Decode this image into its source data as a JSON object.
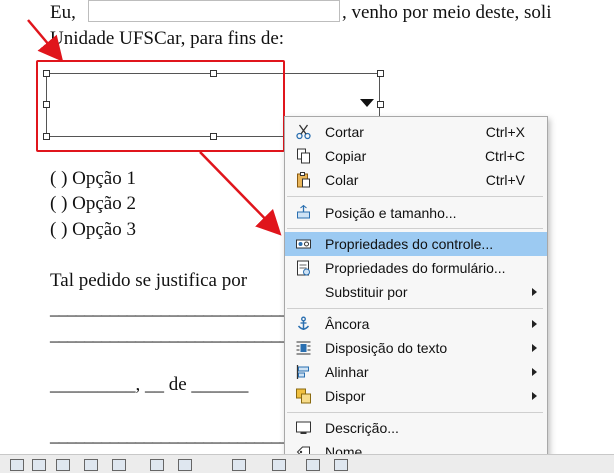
{
  "document": {
    "line1_start": "Eu,",
    "line1_end": ", venho por meio deste, soli",
    "line2": "Unidade UFSCar, para fins de:",
    "options": [
      "( ) Opção 1",
      "( ) Opção 2",
      "( ) Opção 3"
    ],
    "justify_text": "Tal pedido se justifica por",
    "date_line": "_________, __ de ______",
    "underscores": "___________________________________________"
  },
  "context_menu": {
    "items": [
      {
        "label": "Cortar",
        "shortcut": "Ctrl+X",
        "icon": "scissors-icon"
      },
      {
        "label": "Copiar",
        "shortcut": "Ctrl+C",
        "icon": "copy-icon"
      },
      {
        "label": "Colar",
        "shortcut": "Ctrl+V",
        "icon": "paste-icon"
      },
      {
        "label": "Posição e tamanho...",
        "icon": "position-size-icon"
      },
      {
        "label": "Propriedades do controle...",
        "icon": "control-properties-icon",
        "highlighted": true
      },
      {
        "label": "Propriedades do formulário...",
        "icon": "form-properties-icon"
      },
      {
        "label": "Substituir por",
        "submenu": true
      },
      {
        "label": "Âncora",
        "icon": "anchor-icon",
        "submenu": true
      },
      {
        "label": "Disposição do texto",
        "icon": "text-wrap-icon",
        "submenu": true
      },
      {
        "label": "Alinhar",
        "icon": "align-icon",
        "submenu": true
      },
      {
        "label": "Dispor",
        "icon": "arrange-icon",
        "submenu": true
      },
      {
        "label": "Descrição...",
        "icon": "description-icon"
      },
      {
        "label": "Nome...",
        "icon": "name-icon"
      }
    ]
  },
  "colors": {
    "annotation": "#e0151c",
    "highlight": "#9ccaf2",
    "spellcheck": "#e04040"
  }
}
